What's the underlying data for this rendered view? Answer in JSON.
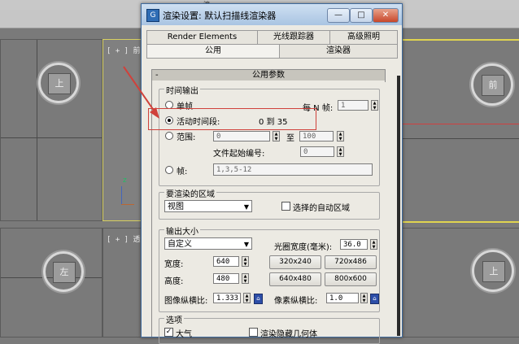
{
  "viewports": {
    "top_strip_text": "渡",
    "top_left_label": "[ + ] 前",
    "bottom_left_label": "[ + ] 透",
    "cube_top_left": "上",
    "cube_top_right": "前",
    "cube_bottom_left": "左",
    "cube_bottom_right": "上"
  },
  "dialog": {
    "title": "渲染设置: 默认扫描线渲染器",
    "icon_glyph": "G",
    "min_label": "—",
    "max_label": "□",
    "close_label": "✕",
    "tabs_row1": [
      "Render Elements",
      "光线跟踪器",
      "高级照明"
    ],
    "tabs_row2": [
      "公用",
      "渲染器"
    ],
    "rollout_title": "公用参数",
    "rollout_toggle": "-",
    "time_output": {
      "title": "时间输出",
      "single": "单帧",
      "every_n_label": "每 N 帧:",
      "every_n_value": "1",
      "active": "活动时间段:",
      "active_range": "0 到 35",
      "range": "范围:",
      "range_from": "0",
      "range_to_label": "至",
      "range_to": "100",
      "file_start_label": "文件起始编号:",
      "file_start": "0",
      "frames": "帧:",
      "frames_value": "1,3,5-12"
    },
    "area": {
      "title": "要渲染的区域",
      "dropdown": "视图",
      "auto_region": "选择的自动区域"
    },
    "output_size": {
      "title": "输出大小",
      "preset": "自定义",
      "aperture_label": "光圈宽度(毫米):",
      "aperture_value": "36.0",
      "width_label": "宽度:",
      "width_value": "640",
      "height_label": "高度:",
      "height_value": "480",
      "presets": [
        "320x240",
        "720x486",
        "640x480",
        "800x600"
      ],
      "image_aspect_label": "图像纵横比:",
      "image_aspect_value": "1.333",
      "pixel_aspect_label": "像素纵横比:",
      "pixel_aspect_value": "1.0"
    },
    "options": {
      "title": "选项",
      "atmosphere": "大气",
      "render_hidden": "渲染隐藏几何体"
    }
  }
}
